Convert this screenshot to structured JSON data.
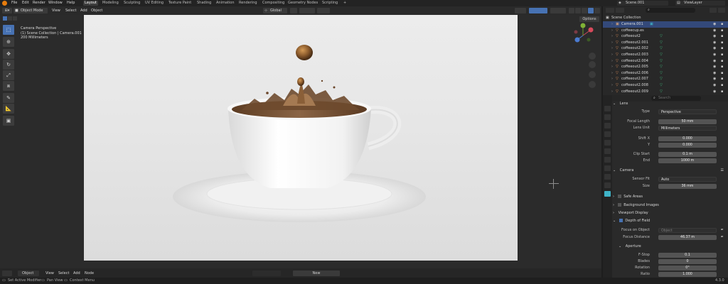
{
  "menubar": {
    "items": [
      "File",
      "Edit",
      "Render",
      "Window",
      "Help"
    ],
    "workspaces": [
      "Layout",
      "Modeling",
      "Sculpting",
      "UV Editing",
      "Texture Paint",
      "Shading",
      "Animation",
      "Rendering",
      "Compositing",
      "Geometry Nodes",
      "Scripting"
    ],
    "active_workspace": "Layout",
    "scene": "Scene.001",
    "view_layer": "ViewLayer"
  },
  "viewport_header": {
    "mode": "Object Mode",
    "menus": [
      "View",
      "Select",
      "Add",
      "Object"
    ],
    "orientation": "Global",
    "options": "Options"
  },
  "overlay_text": {
    "line1": "Camera Perspective",
    "line2": "(1) Scene Collection | Camera.001",
    "line3": "200 Millimeters"
  },
  "outliner": {
    "search_placeholder": "",
    "root": "Scene Collection",
    "rows": [
      {
        "name": "Camera.001"
      },
      {
        "name": "coffeecup.es"
      },
      {
        "name": "coffeeout2"
      },
      {
        "name": "coffeeout2.001"
      },
      {
        "name": "coffeeout2.002"
      },
      {
        "name": "coffeeout2.003"
      },
      {
        "name": "coffeeout2.004"
      },
      {
        "name": "coffeeout2.005"
      },
      {
        "name": "coffeeout2.006"
      },
      {
        "name": "coffeeout2.007"
      },
      {
        "name": "coffeeout2.008"
      },
      {
        "name": "coffeeout2.009"
      }
    ]
  },
  "properties": {
    "search_placeholder": "Search",
    "lens_section": "Lens",
    "type_label": "Type",
    "type_value": "Perspective",
    "focal_label": "Focal Length",
    "focal_value": "50 mm",
    "lens_unit_label": "Lens Unit",
    "lens_unit_value": "Millimeters",
    "shift_x_label": "Shift X",
    "shift_x_value": "0.000",
    "shift_y_label": "Y",
    "shift_y_value": "0.000",
    "clip_start_label": "Clip Start",
    "clip_start_value": "0.1 m",
    "clip_end_label": "End",
    "clip_end_value": "1000 m",
    "camera_section": "Camera",
    "sensor_fit_label": "Sensor Fit",
    "sensor_fit_value": "Auto",
    "size_label": "Size",
    "size_value": "36 mm",
    "safe_areas": "Safe Areas",
    "background_images": "Background Images",
    "viewport_display": "Viewport Display",
    "dof_section": "Depth of Field",
    "focus_object_label": "Focus on Object",
    "focus_object_value": "Object",
    "focus_distance_label": "Focus Distance",
    "focus_distance_value": "46.37 m",
    "aperture_section": "Aperture",
    "fstop_label": "F-Stop",
    "fstop_value": "0.1",
    "blades_label": "Blades",
    "blades_value": "0",
    "rotation_label": "Rotation",
    "rotation_value": "0°",
    "ratio_label": "Ratio",
    "ratio_value": "1.000"
  },
  "timeline_header": {
    "mode": "Object",
    "menus": [
      "View",
      "Select",
      "Add",
      "Node"
    ],
    "new_label": "New"
  },
  "statusbar": {
    "item1": "Set Active Modifier",
    "item2": "Pan View",
    "item3": "Context Menu",
    "version": "4.3.0"
  },
  "colors": {
    "accent": "#4772b3",
    "selected_row": "#33497a",
    "mesh_green": "#3fbf7f",
    "camera_cyan": "#3fb3c7"
  }
}
